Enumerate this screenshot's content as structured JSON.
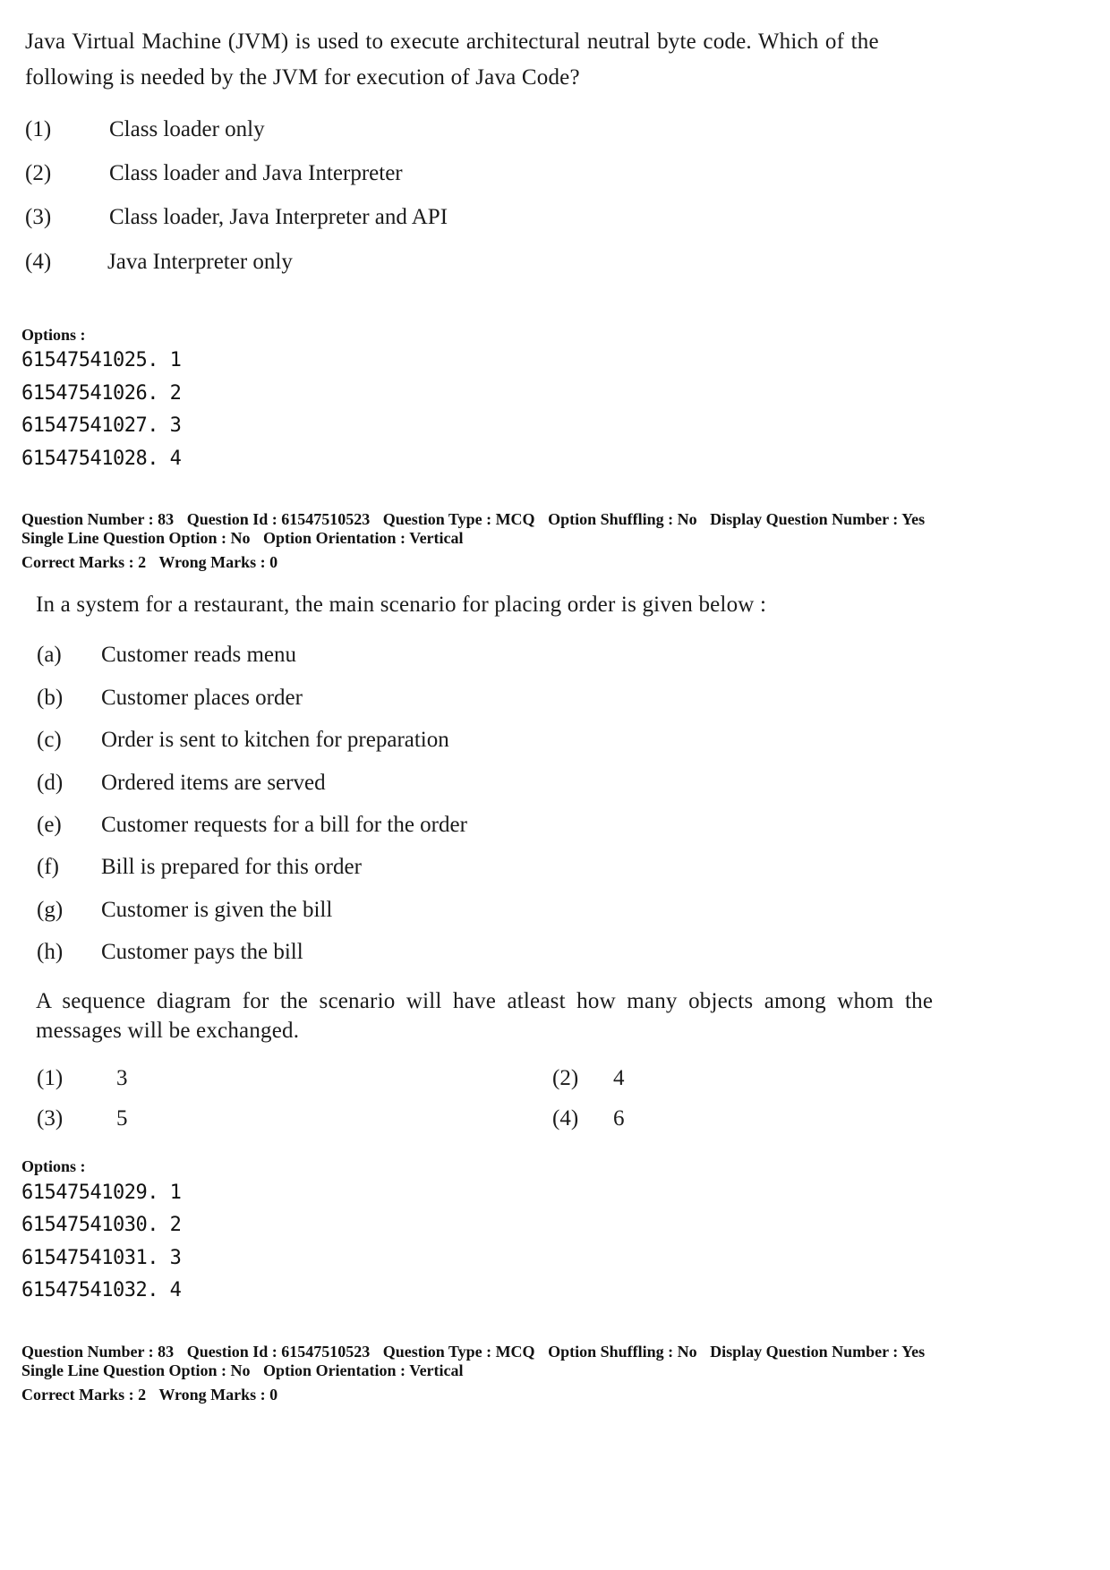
{
  "question_prev": {
    "stem_line1": "Java Virtual Machine (JVM) is used to execute architectural neutral byte code. Which of the",
    "stem_line2": "following is needed by the JVM for execution of Java Code?",
    "choices": [
      {
        "num": "(1)",
        "text": "Class loader only"
      },
      {
        "num": "(2)",
        "text": "Class loader and Java Interpreter"
      },
      {
        "num": "(3)",
        "text": "Class loader, Java Interpreter and API"
      },
      {
        "num": "(4)",
        "text": "Java Interpreter only"
      }
    ],
    "options_label": "Options :",
    "options": [
      "61547541025. 1",
      "61547541026. 2",
      "61547541027. 3",
      "61547541028. 4"
    ]
  },
  "meta_block_1": {
    "line1": [
      "Question Number : 83",
      "Question Id : 61547510523",
      "Question Type : MCQ",
      "Option Shuffling : No",
      "Display Question Number : Yes"
    ],
    "line2": [
      "Single Line Question Option : No",
      "Option Orientation : Vertical"
    ],
    "line3": [
      "Correct Marks : 2",
      "Wrong Marks : 0"
    ]
  },
  "question_83": {
    "intro": "In a system for a restaurant, the main scenario for placing order is given below :",
    "steps": [
      {
        "label": "(a)",
        "text": "Customer reads menu"
      },
      {
        "label": "(b)",
        "text": "Customer places order"
      },
      {
        "label": "(c)",
        "text": "Order is sent to kitchen for preparation"
      },
      {
        "label": "(d)",
        "text": "Ordered items are served"
      },
      {
        "label": "(e)",
        "text": "Customer requests for a bill for the order"
      },
      {
        "label": "(f)",
        "text": "Bill is prepared for this order"
      },
      {
        "label": "(g)",
        "text": "Customer is given the bill"
      },
      {
        "label": "(h)",
        "text": "Customer pays the bill"
      }
    ],
    "question_line1": "A sequence diagram for the scenario will have atleast how many objects among whom the",
    "question_line2": "messages will be exchanged.",
    "choices": [
      {
        "num": "(1)",
        "text": "3"
      },
      {
        "num": "(2)",
        "text": "4"
      },
      {
        "num": "(3)",
        "text": "5"
      },
      {
        "num": "(4)",
        "text": "6"
      }
    ],
    "options_label": "Options :",
    "options": [
      "61547541029. 1",
      "61547541030. 2",
      "61547541031. 3",
      "61547541032. 4"
    ]
  },
  "meta_block_2": {
    "line1": [
      "Question Number : 83",
      "Question Id : 61547510523",
      "Question Type : MCQ",
      "Option Shuffling : No",
      "Display Question Number : Yes"
    ],
    "line2": [
      "Single Line Question Option : No",
      "Option Orientation : Vertical"
    ],
    "line3": [
      "Correct Marks : 2",
      "Wrong Marks : 0"
    ]
  }
}
